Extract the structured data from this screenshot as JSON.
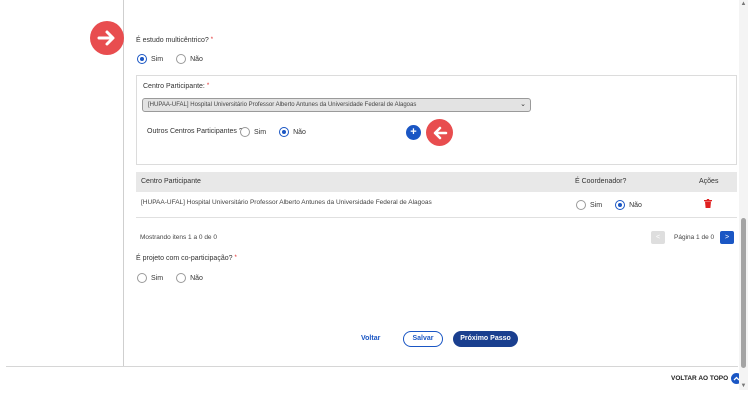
{
  "q_multicentrico": {
    "label": "É estudo multicêntrico?",
    "required": "*",
    "options": [
      {
        "label": "Sim",
        "checked": true
      },
      {
        "label": "Não",
        "checked": false
      }
    ]
  },
  "centro_participante": {
    "label": "Centro Participante:",
    "required": "*",
    "selected": "[HUPAA-UFAL] Hospital Universitário Professor Alberto Antunes da Universidade Federal de Alagoas"
  },
  "outros_centros": {
    "label": "Outros Centros Participantes ?",
    "options": [
      {
        "label": "Sim",
        "checked": false
      },
      {
        "label": "Não",
        "checked": true
      }
    ],
    "add_symbol": "+"
  },
  "table": {
    "headers": [
      "Centro Participante",
      "É Coordenador?",
      "Ações"
    ],
    "rows": [
      {
        "centro": "[HUPAA-UFAL] Hospital Universitário Professor Alberto Antunes da Universidade Federal de Alagoas",
        "coord_options": [
          {
            "label": "Sim",
            "checked": false
          },
          {
            "label": "Não",
            "checked": true
          }
        ]
      }
    ]
  },
  "pager": {
    "info": "Mostrando itens 1 a 0 de 0",
    "label": "Página 1 de 0",
    "prev": "<",
    "next": ">"
  },
  "q_coparticipacao": {
    "label": "É projeto com co-participação?",
    "required": "*",
    "options": [
      {
        "label": "Sim",
        "checked": false
      },
      {
        "label": "Não",
        "checked": false
      }
    ]
  },
  "actions": {
    "voltar": "Voltar",
    "salvar": "Salvar",
    "proximo": "Próximo Passo"
  },
  "back_to_top": "VOLTAR AO TOPO",
  "colors": {
    "primary": "#1a56c4",
    "dark_primary": "#1a3f8f",
    "annotation": "#e84d4f",
    "danger": "#e02020"
  },
  "icons": [
    "arrow-right-icon",
    "arrow-left-icon",
    "plus-icon",
    "trash-icon",
    "chevron-down-icon",
    "chevron-up-icon"
  ]
}
